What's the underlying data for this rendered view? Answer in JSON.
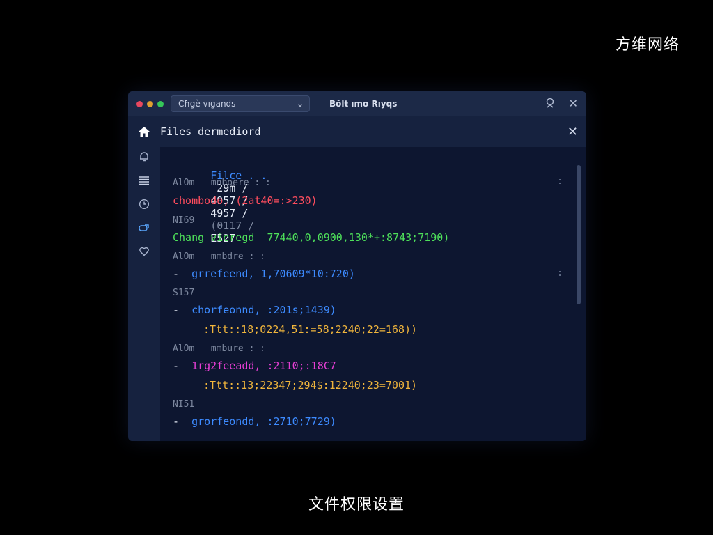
{
  "brand": "方维网络",
  "caption": "文件权限设置",
  "window": {
    "selector_label": "Cħgè vıgands",
    "title": "Bŏlŧ ımo Rıyqs",
    "traffic_colors": {
      "close": "#e8475f",
      "minimize": "#e0a030",
      "maximize": "#35c759"
    }
  },
  "panel": {
    "title": "Files dermediord"
  },
  "sidebar": {
    "items": [
      {
        "icon": "home-icon"
      },
      {
        "icon": "bell-icon"
      },
      {
        "icon": "list-icon"
      },
      {
        "icon": "clock-icon"
      },
      {
        "icon": "link-icon"
      },
      {
        "icon": "heart-icon"
      }
    ]
  },
  "content": {
    "header": {
      "label": "Filce . .",
      "c1": "29m /",
      "c2": "4957 /",
      "c3": "4957 /",
      "c4": "(0117 /",
      "c5": "E527"
    },
    "lines": [
      {
        "text": "AlOm   mnboere : :",
        "color": "#7c879e"
      },
      {
        "text": "chombodo, (2at40=:>230)",
        "color": "#ff4d5e"
      },
      {
        "text": "NI69",
        "color": "#7c879e"
      },
      {
        "text": "Chang vieregd  77440,0,0900,130*+:8743;7190)",
        "color": "#4ee05a"
      },
      {
        "text": "AlOm   mmbdre : :",
        "color": "#7c879e"
      },
      {
        "text": "grrefeend, 1,70609*10:720)",
        "color": "#3d8bff"
      },
      {
        "text": "S157",
        "color": "#7c879e"
      },
      {
        "text": "chorfeonnd, :201s;1439)",
        "color": "#3d8bff"
      },
      {
        "text": ":Ttt::18;0224,51:=58;2240;22=168))",
        "color": "#f0b53c"
      },
      {
        "text": "AlOm   mmbure : :",
        "color": "#7c879e"
      },
      {
        "text": "1rg2feeadd, :2110;:18C7",
        "color": "#e63ed4"
      },
      {
        "text": ":Ttt::13;22347;294$:12240;23=7001)",
        "color": "#f0b53c"
      },
      {
        "text": "NI51",
        "color": "#7c879e"
      },
      {
        "text": "grorfeondd, :2710;7729)",
        "color": "#3d8bff"
      }
    ],
    "dash": "-",
    "dots": ":"
  }
}
